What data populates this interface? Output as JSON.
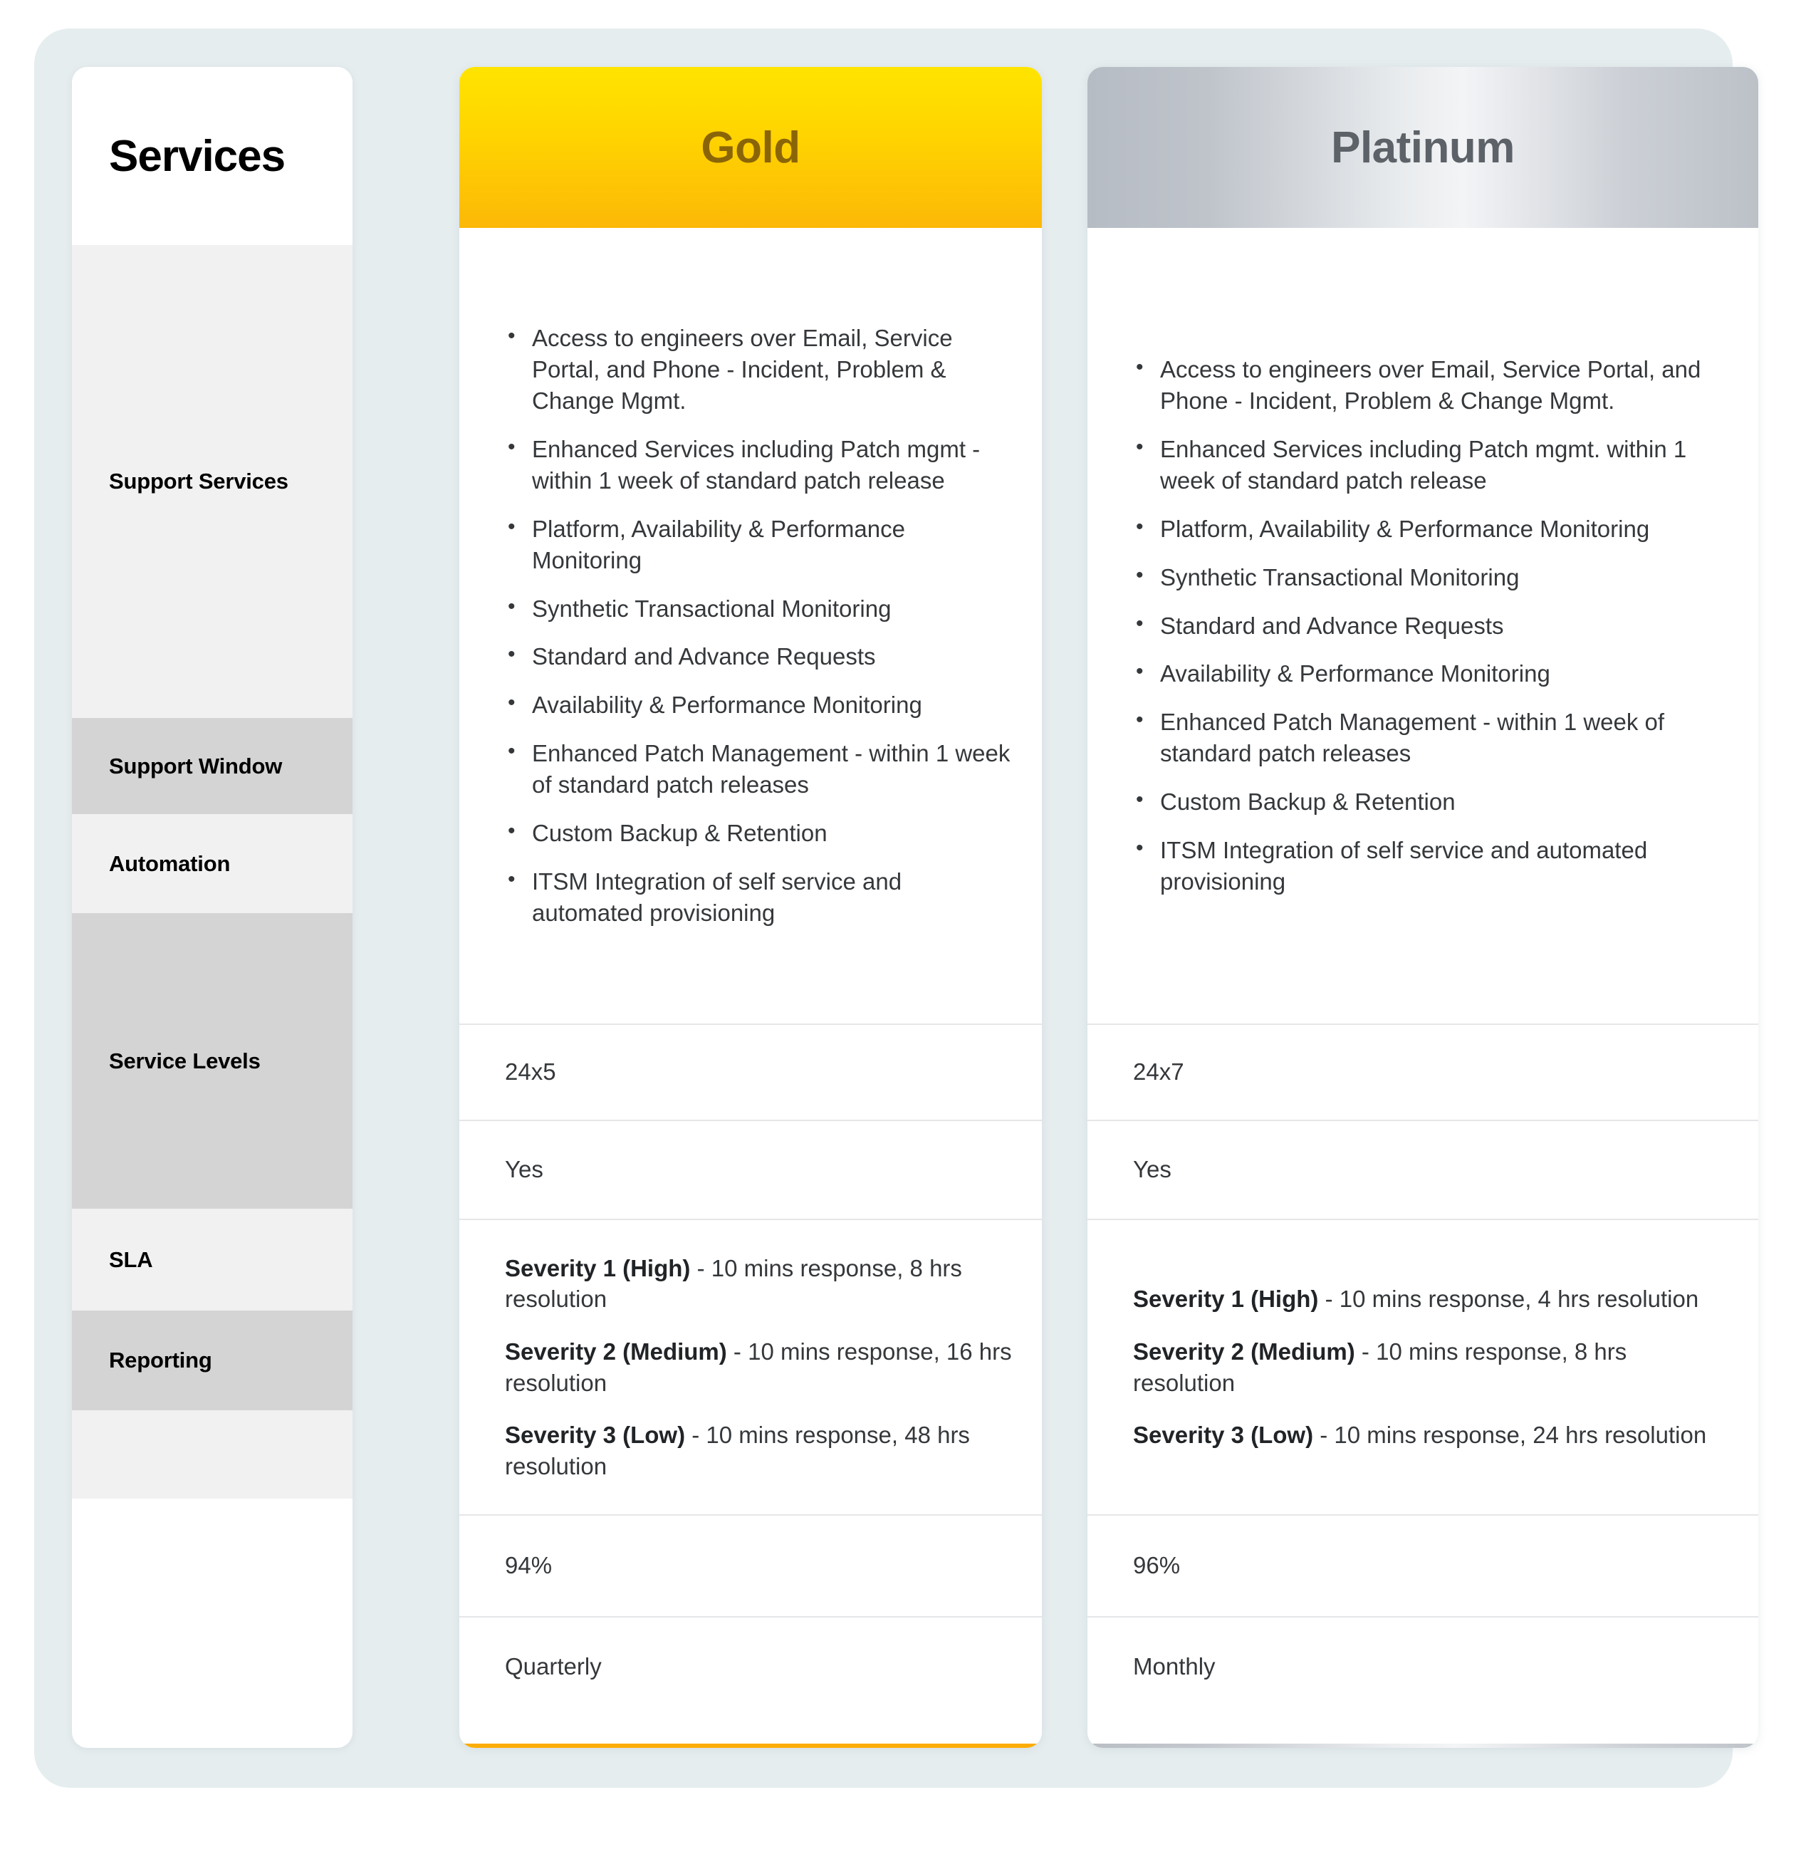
{
  "table": {
    "services_header": "Services",
    "row_labels": [
      "Support Services",
      "Support Window",
      "Automation",
      "Service Levels",
      "SLA",
      "Reporting"
    ]
  },
  "gold": {
    "title": "Gold",
    "header_bg_top": "#FFE400",
    "header_bg_bottom": "#FCB807",
    "footer_bg": "#FBAD06",
    "title_color": "#8A6508",
    "support_services": [
      "Access to engineers over Email, Service Portal, and Phone - Incident, Problem & Change Mgmt.",
      "Enhanced Services including Patch mgmt - within 1 week of standard patch release",
      "Platform, Availability & Performance Monitoring",
      "Synthetic Transactional Monitoring",
      "Standard and Advance Requests",
      "Availability & Performance Monitoring",
      "Enhanced Patch Management - within 1 week of standard patch releases",
      "Custom Backup & Retention",
      "ITSM Integration of self service and automated provisioning"
    ],
    "support_window": "24x5",
    "automation": "Yes",
    "service_levels": [
      {
        "label": "Severity 1 (High)",
        "detail": " -  10 mins response, 8 hrs resolution"
      },
      {
        "label": "Severity 2 (Medium)",
        "detail": " - 10 mins response, 16 hrs resolution"
      },
      {
        "label": "Severity 3 (Low)",
        "detail": " - 10 mins response, 48 hrs resolution"
      }
    ],
    "sla": "94%",
    "reporting": "Quarterly"
  },
  "platinum": {
    "title": "Platinum",
    "header_bg_edge": "#B6BCC4",
    "header_bg_center": "#F3F4F6",
    "title_color": "#5C6268",
    "support_services": [
      "Access to engineers over Email, Service Portal, and Phone - Incident, Problem & Change Mgmt.",
      "Enhanced Services including Patch mgmt. within 1 week of standard patch release",
      "Platform, Availability & Performance Monitoring",
      "Synthetic Transactional Monitoring",
      "Standard and Advance Requests",
      "Availability & Performance Monitoring",
      "Enhanced Patch Management - within 1 week of standard patch releases",
      "Custom Backup & Retention",
      "ITSM Integration of self service and automated provisioning"
    ],
    "support_window": "24x7",
    "automation": "Yes",
    "service_levels": [
      {
        "label": "Severity 1 (High)",
        "detail": " - 10 mins response, 4 hrs resolution"
      },
      {
        "label": "Severity 2 (Medium)",
        "detail": " - 10 mins response, 8 hrs resolution"
      },
      {
        "label": "Severity 3 (Low)",
        "detail": " - 10 mins response, 24 hrs resolution"
      }
    ],
    "sla": "96%",
    "reporting": "Monthly"
  },
  "theme": {
    "panel_bg": "#E6EDEF",
    "row_light": "#F1F1F1",
    "row_dark": "#D4D4D4"
  }
}
